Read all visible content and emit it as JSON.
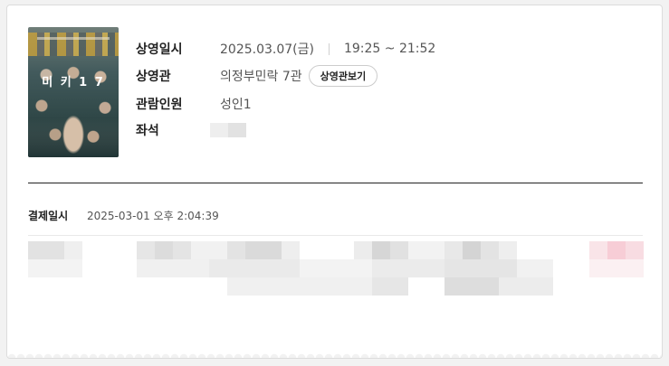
{
  "poster": {
    "title": "미 키 1 7"
  },
  "details": {
    "date_label": "상영일시",
    "date_value": "2025.03.07(금)",
    "time_value": "19:25 ~ 21:52",
    "hall_label": "상영관",
    "hall_value": "의정부민락 7관",
    "hall_button": "상영관보기",
    "audience_label": "관람인원",
    "audience_value": "성인1",
    "seat_label": "좌석"
  },
  "payment": {
    "label": "결제일시",
    "value": "2025-03-01 오후 2:04:39"
  },
  "colors": {
    "text_dark": "#222222",
    "text_muted": "#555555",
    "background": "#f2f2f2"
  }
}
